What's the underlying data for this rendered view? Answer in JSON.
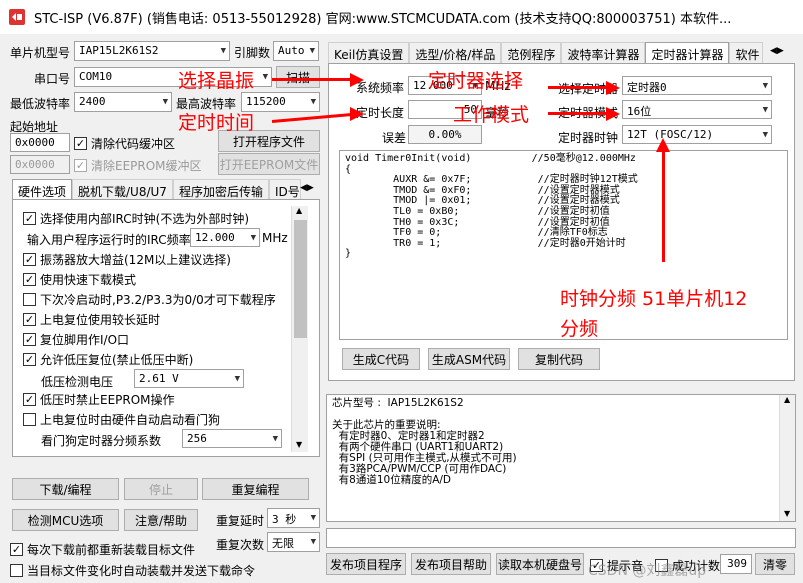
{
  "window": {
    "title": "STC-ISP (V6.87F) (销售电话: 0513-55012928) 官网:www.STCMCUDATA.com  (技术支持QQ:800003751) 本软件..."
  },
  "left": {
    "mcu_type_label": "单片机型号",
    "mcu_type_value": "IAP15L2K61S2",
    "pin_label": "引脚数",
    "pin_value": "Auto",
    "port_label": "串口号",
    "port_value": "COM10",
    "scan_button": "扫描",
    "min_baud_label": "最低波特率",
    "min_baud_value": "2400",
    "max_baud_label": "最高波特率",
    "max_baud_value": "115200",
    "start_addr_label": "起始地址",
    "addr1_value": "0x0000",
    "clear_code_label": "清除代码缓冲区",
    "open_program_button": "打开程序文件",
    "addr2_value": "0x0000",
    "clear_eeprom_label": "清除EEPROM缓冲区",
    "open_eeprom_button": "打开EEPROM文件",
    "tabs": [
      "硬件选项",
      "脱机下载/U8/U7",
      "程序加密后传输",
      "ID号"
    ],
    "options": [
      "选择使用内部IRC时钟(不选为外部时钟)",
      "振荡器放大增益(12M以上建议选择)",
      "使用快速下载模式",
      "下次冷启动时,P3.2/P3.3为0/0才可下载程序",
      "上电复位使用较长延时",
      "复位脚用作I/O口",
      "允许低压复位(禁止低压中断)",
      "低压时禁止EEPROM操作",
      "上电复位时由硬件自动启动看门狗"
    ],
    "irc_label": "输入用户程序运行时的IRC频率",
    "irc_value": "12.000",
    "irc_unit": "MHz",
    "lv_label": "低压检测电压",
    "lv_value": "2.61 V",
    "wdt_label": "看门狗定时器分频系数",
    "wdt_value": "256",
    "download_button": "下载/编程",
    "stop_button": "停止",
    "reprogram_button": "重复编程",
    "detect_button": "检测MCU选项",
    "help_button": "注意/帮助",
    "repeat_delay_label": "重复延时",
    "repeat_delay_value": "3 秒",
    "repeat_count_label": "重复次数",
    "repeat_count_value": "无限",
    "reload_label": "每次下载前都重新装载目标文件",
    "auto_load_label": "当目标文件变化时自动装载并发送下载命令"
  },
  "right": {
    "tabs": [
      "Keil仿真设置",
      "选型/价格/样品",
      "范例程序",
      "波特率计算器",
      "定时器计算器",
      "软件"
    ],
    "sys_freq_label": "系统频率",
    "sys_freq_value": "12.000",
    "sys_freq_unit": "MHz",
    "timer_len_label": "定时长度",
    "timer_len_value": "50",
    "timer_len_unit": "毫秒",
    "error_label": "误差",
    "error_value": "0.00%",
    "select_timer_label": "选择定时器",
    "select_timer_value": "定时器0",
    "timer_mode_label": "定时器模式",
    "timer_mode_value": "16位",
    "timer_clock_label": "定时器时钟",
    "timer_clock_value": "12T (FOSC/12)",
    "code": "void Timer0Init(void)          //50毫秒@12.000MHz\n{\n        AUXR &= 0x7F;           //定时器时钟12T模式\n        TMOD &= 0xF0;           //设置定时器模式\n        TMOD |= 0x01;           //设置定时器模式\n        TL0 = 0xB0;             //设置定时初值\n        TH0 = 0x3C;             //设置定时初值\n        TF0 = 0;                //清除TF0标志\n        TR0 = 1;                //定时器0开始计时\n}",
    "gen_c_button": "生成C代码",
    "gen_asm_button": "生成ASM代码",
    "copy_button": "复制代码",
    "info_text": "芯片型号 :  IAP15L2K61S2\n\n关于此芯片的重要说明:\n  有定时器0、定时器1和定时器2\n  有两个硬件串口 (UART1和UART2)\n  有SPI (只可用作主模式,从模式不可用)\n  有3路PCA/PWM/CCP (可用作DAC)\n  有8通道10位精度的A/D",
    "publish_button": "发布项目程序",
    "publish_help_button": "发布项目帮助",
    "read_disk_button": "读取本机硬盘号",
    "sound_label": "提示音",
    "success_count_label": "成功计数",
    "success_count_value": "309",
    "clear_button": "清零"
  },
  "annotations": {
    "select_crystal": "选择晶振",
    "timer_time": "定时时间",
    "timer_select": "定时器选择",
    "work_mode": "工作模式",
    "clock_div_1": "时钟分频 51单片机12",
    "clock_div_2": "分频"
  },
  "watermark": "CSDN @刘鑫磊up"
}
